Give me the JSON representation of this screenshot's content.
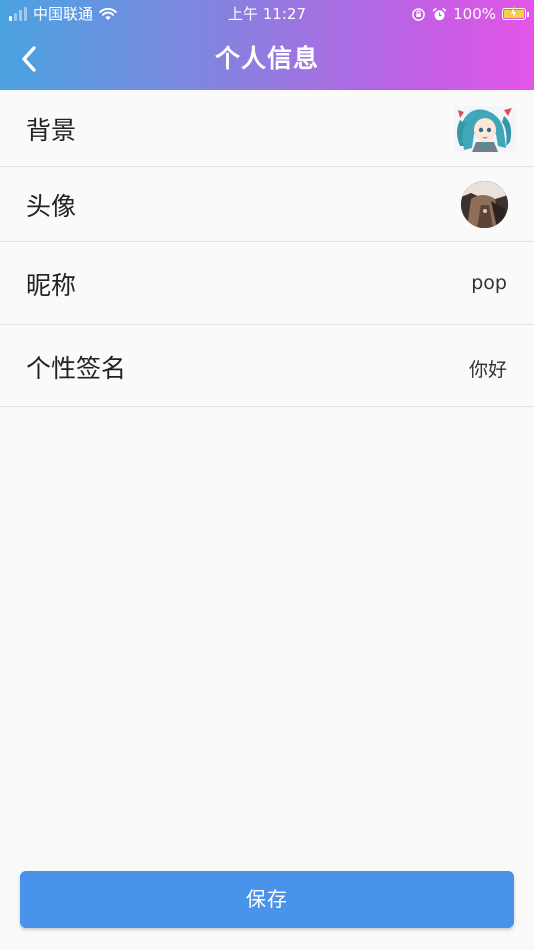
{
  "status_bar": {
    "carrier": "中国联通",
    "time": "上午 11:27",
    "battery_percent": "100%",
    "signal_bars": 4,
    "signal_bars_filled": 1
  },
  "nav": {
    "title": "个人信息",
    "back_icon": "chevron-left-icon"
  },
  "rows": [
    {
      "label": "背景",
      "type": "image"
    },
    {
      "label": "头像",
      "type": "avatar"
    },
    {
      "label": "昵称",
      "value": "pop"
    },
    {
      "label": "个性签名",
      "value": "你好"
    }
  ],
  "save_button": {
    "label": "保存"
  },
  "colors": {
    "header_gradient_start": "#4aa3e0",
    "header_gradient_end": "#e455e6",
    "primary_button": "#4a93ea",
    "battery_fill": "#f7d04a"
  }
}
